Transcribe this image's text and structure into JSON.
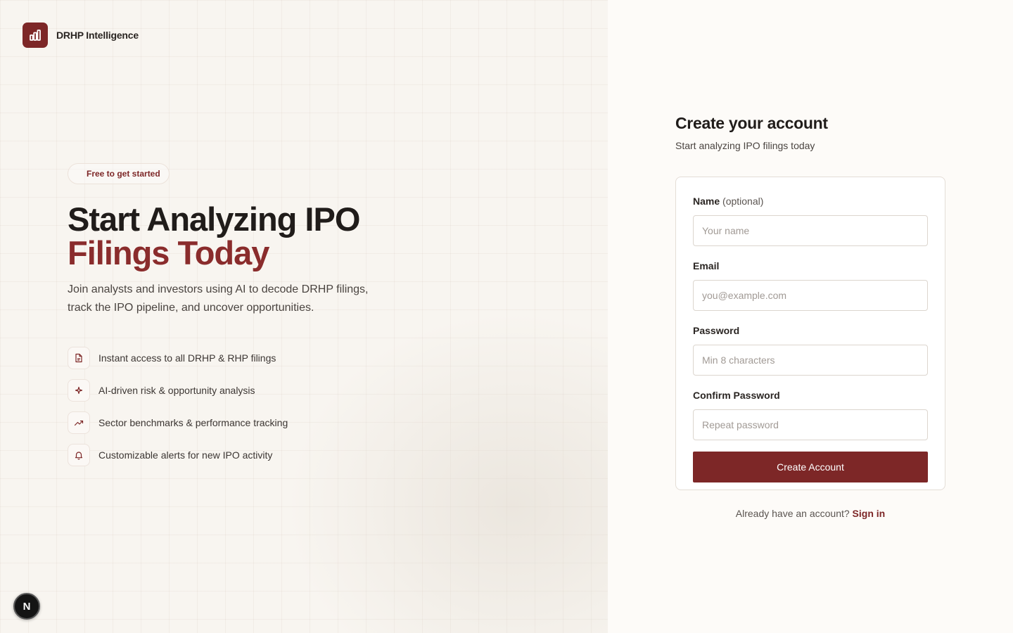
{
  "brand": {
    "name": "DRHP Intelligence",
    "logo_icon": "bar-chart-icon",
    "accent_color": "#7d2727"
  },
  "hero": {
    "badge": "Free to get started",
    "headline_line1": "Start Analyzing IPO",
    "headline_line2": "Filings Today",
    "subtitle": "Join analysts and investors using AI to decode DRHP filings, track the IPO pipeline, and uncover opportunities."
  },
  "features": [
    {
      "icon": "document-icon",
      "text": "Instant access to all DRHP & RHP filings"
    },
    {
      "icon": "sparkle-icon",
      "text": "AI-driven risk & opportunity analysis"
    },
    {
      "icon": "trending-up-icon",
      "text": "Sector benchmarks & performance tracking"
    },
    {
      "icon": "bell-icon",
      "text": "Customizable alerts for new IPO activity"
    }
  ],
  "form": {
    "title": "Create your account",
    "subtitle": "Start analyzing IPO filings today",
    "name": {
      "label": "Name",
      "optional": "(optional)",
      "placeholder": "Your name",
      "value": ""
    },
    "email": {
      "label": "Email",
      "placeholder": "you@example.com",
      "value": ""
    },
    "password": {
      "label": "Password",
      "placeholder": "Min 8 characters",
      "value": ""
    },
    "confirm_password": {
      "label": "Confirm Password",
      "placeholder": "Repeat password",
      "value": ""
    },
    "submit_label": "Create Account"
  },
  "footer": {
    "prompt": "Already have an account?",
    "link_label": "Sign in"
  },
  "dev_badge": {
    "letter": "N"
  }
}
